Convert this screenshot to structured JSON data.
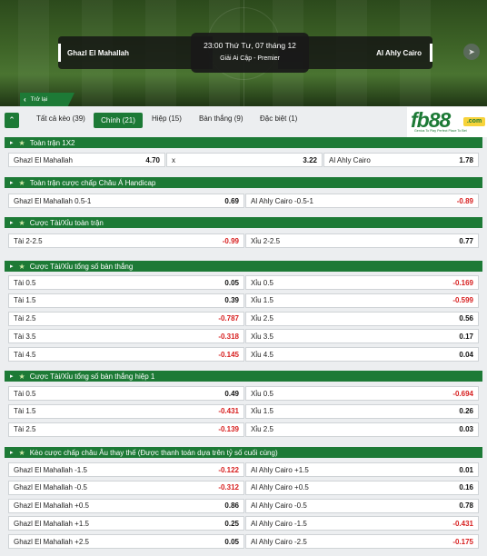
{
  "match": {
    "home": "Ghazl El Mahallah",
    "away": "Al Ahly Cairo",
    "datetime": "23:00 Thứ Tư, 07 tháng 12",
    "league": "Giải Ai Cập - Premier",
    "back_label": "Trở lại"
  },
  "tabs": [
    {
      "label": "Tất cả kèo (39)"
    },
    {
      "label": "Chính (21)"
    },
    {
      "label": "Hiệp (15)"
    },
    {
      "label": "Bàn thắng (9)"
    },
    {
      "label": "Đặc biệt (1)"
    }
  ],
  "logo": {
    "brand": "fb88",
    "domain": ".com",
    "tagline": "Genius To Play   Perfect Place To Bet"
  },
  "sections": [
    {
      "title": "Toàn trận 1X2",
      "rows": [
        [
          {
            "name": "Ghazl El Mahallah",
            "value": "4.70"
          },
          {
            "name": "x",
            "value": "3.22"
          },
          {
            "name": "Al Ahly Cairo",
            "value": "1.78"
          }
        ]
      ]
    },
    {
      "title": "Toàn trận cược chấp Châu Á Handicap",
      "rows": [
        [
          {
            "name": "Ghazl El Mahallah  0.5-1",
            "value": "0.69"
          },
          {
            "name": "Al Ahly Cairo  -0.5-1",
            "value": "-0.89"
          }
        ]
      ]
    },
    {
      "title": "Cược Tài/Xỉu toàn trận",
      "rows": [
        [
          {
            "name": "Tài  2-2.5",
            "value": "-0.99"
          },
          {
            "name": "Xỉu  2-2.5",
            "value": "0.77"
          }
        ]
      ]
    },
    {
      "title": "Cược Tài/Xỉu tổng số bàn thắng",
      "rows": [
        [
          {
            "name": "Tài  0.5",
            "value": "0.05"
          },
          {
            "name": "Xỉu  0.5",
            "value": "-0.169"
          }
        ],
        [
          {
            "name": "Tài  1.5",
            "value": "0.39"
          },
          {
            "name": "Xỉu  1.5",
            "value": "-0.599"
          }
        ],
        [
          {
            "name": "Tài  2.5",
            "value": "-0.787"
          },
          {
            "name": "Xỉu  2.5",
            "value": "0.56"
          }
        ],
        [
          {
            "name": "Tài  3.5",
            "value": "-0.318"
          },
          {
            "name": "Xỉu  3.5",
            "value": "0.17"
          }
        ],
        [
          {
            "name": "Tài  4.5",
            "value": "-0.145"
          },
          {
            "name": "Xỉu  4.5",
            "value": "0.04"
          }
        ]
      ]
    },
    {
      "title": "Cược Tài/Xỉu tổng số bàn thắng hiệp 1",
      "rows": [
        [
          {
            "name": "Tài  0.5",
            "value": "0.49"
          },
          {
            "name": "Xỉu  0.5",
            "value": "-0.694"
          }
        ],
        [
          {
            "name": "Tài  1.5",
            "value": "-0.431"
          },
          {
            "name": "Xỉu  1.5",
            "value": "0.26"
          }
        ],
        [
          {
            "name": "Tài  2.5",
            "value": "-0.139"
          },
          {
            "name": "Xỉu  2.5",
            "value": "0.03"
          }
        ]
      ]
    },
    {
      "title": "Kèo cược chấp châu Âu thay thế (Được thanh toán dựa trên tỷ số cuối cùng)",
      "rows": [
        [
          {
            "name": "Ghazl El Mahallah  -1.5",
            "value": "-0.122"
          },
          {
            "name": "Al Ahly Cairo  +1.5",
            "value": "0.01"
          }
        ],
        [
          {
            "name": "Ghazl El Mahallah  -0.5",
            "value": "-0.312"
          },
          {
            "name": "Al Ahly Cairo  +0.5",
            "value": "0.16"
          }
        ],
        [
          {
            "name": "Ghazl El Mahallah  +0.5",
            "value": "0.86"
          },
          {
            "name": "Al Ahly Cairo  -0.5",
            "value": "0.78"
          }
        ],
        [
          {
            "name": "Ghazl El Mahallah  +1.5",
            "value": "0.25"
          },
          {
            "name": "Al Ahly Cairo  -1.5",
            "value": "-0.431"
          }
        ],
        [
          {
            "name": "Ghazl El Mahallah  +2.5",
            "value": "0.05"
          },
          {
            "name": "Al Ahly Cairo  -2.5",
            "value": "-0.175"
          }
        ]
      ]
    }
  ],
  "colors": {
    "accent": "#1d7a36",
    "negative": "#d71f1f"
  }
}
